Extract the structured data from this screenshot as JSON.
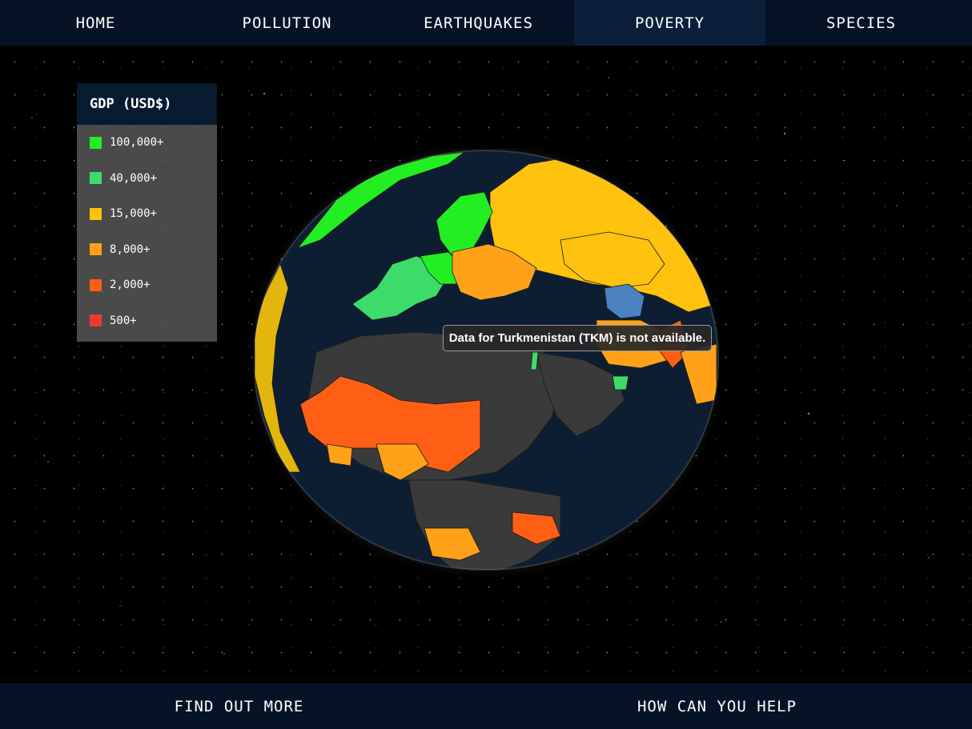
{
  "nav": {
    "tabs": [
      {
        "label": "HOME"
      },
      {
        "label": "POLLUTION"
      },
      {
        "label": "EARTHQUAKES"
      },
      {
        "label": "POVERTY"
      },
      {
        "label": "SPECIES"
      }
    ],
    "active_tab": "POVERTY"
  },
  "legend": {
    "title": "GDP (USD$)",
    "items": [
      {
        "label": "100,000+",
        "color": "#22ee22"
      },
      {
        "label": "40,000+",
        "color": "#3ddc6a"
      },
      {
        "label": "15,000+",
        "color": "#ffc20e"
      },
      {
        "label": "8,000+",
        "color": "#ffa21a"
      },
      {
        "label": "2,000+",
        "color": "#ff5f14"
      },
      {
        "label": "500+",
        "color": "#ee3b30"
      }
    ]
  },
  "map": {
    "no_data_color": "#3a3a3a",
    "ocean_color": "#0e1e32",
    "selected_color": "#4a83bf"
  },
  "tooltip": {
    "text": "Data for Turkmenistan (TKM) is not available."
  },
  "footer": {
    "find_out_more": "FIND OUT MORE",
    "how_can_you_help": "HOW CAN YOU HELP"
  }
}
